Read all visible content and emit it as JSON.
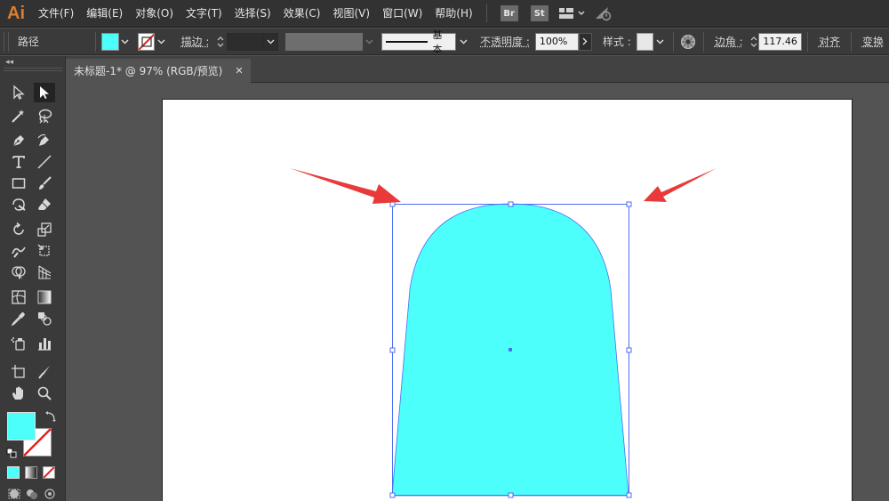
{
  "app": {
    "logo": "Ai"
  },
  "menu": {
    "items": [
      "文件(F)",
      "编辑(E)",
      "对象(O)",
      "文字(T)",
      "选择(S)",
      "效果(C)",
      "视图(V)",
      "窗口(W)",
      "帮助(H)"
    ],
    "badges": [
      "Br",
      "St"
    ]
  },
  "controlbar": {
    "object_type": "路径",
    "fill_color": "#4cfffb",
    "stroke_label": "描边 :",
    "stroke_style": "基本",
    "opacity_label": "不透明度 :",
    "opacity_value": "100%",
    "style_label": "样式 :",
    "corner_label": "边角 :",
    "corner_value": "117.46 px",
    "align_label": "对齐",
    "transform_label": "变换"
  },
  "document": {
    "tab_title": "未标题-1* @ 97% (RGB/预览)",
    "close_glyph": "✕"
  },
  "canvas": {
    "shape_fill": "#4cfffb",
    "selection_color": "#4f6ef5",
    "arrow_color": "#e83a3a"
  },
  "tools": [
    "selection",
    "direct-selection",
    "magic-wand",
    "lasso",
    "pen",
    "curvature",
    "type",
    "line",
    "rectangle",
    "paintbrush",
    "shaper",
    "eraser",
    "rotate",
    "scale",
    "warp",
    "free-transform",
    "shape-builder",
    "perspective-grid",
    "mesh",
    "gradient",
    "eyedropper",
    "blend",
    "symbol-sprayer",
    "column-graph",
    "artboard",
    "slice",
    "hand",
    "zoom"
  ]
}
